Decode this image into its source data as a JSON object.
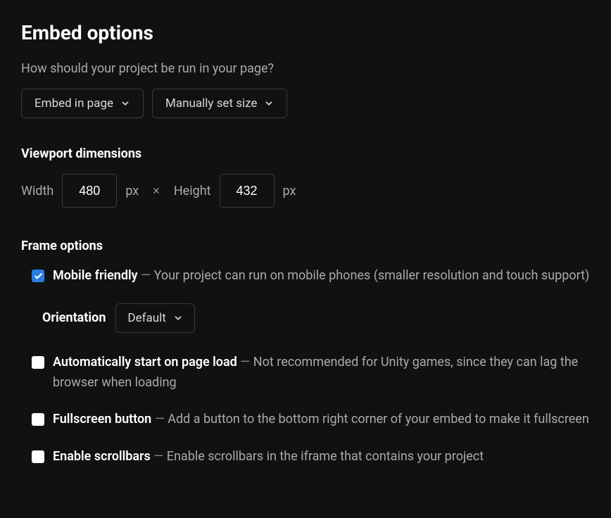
{
  "title": "Embed options",
  "question": "How should your project be run in your page?",
  "dropdowns": {
    "embed_mode": "Embed in page",
    "size_mode": "Manually set size"
  },
  "viewport": {
    "header": "Viewport dimensions",
    "width_label": "Width",
    "width_value": "480",
    "height_label": "Height",
    "height_value": "432",
    "unit": "px",
    "times": "×"
  },
  "frame": {
    "header": "Frame options",
    "mobile": {
      "label": "Mobile friendly",
      "description": "Your project can run on mobile phones (smaller resolution and touch support)",
      "checked": true
    },
    "orientation": {
      "label": "Orientation",
      "value": "Default"
    },
    "autostart": {
      "label": "Automatically start on page load",
      "description": "Not recommended for Unity games, since they can lag the browser when loading",
      "checked": false
    },
    "fullscreen": {
      "label": "Fullscreen button",
      "description": "Add a button to the bottom right corner of your embed to make it fullscreen",
      "checked": false
    },
    "scrollbars": {
      "label": "Enable scrollbars",
      "description": "Enable scrollbars in the iframe that contains your project",
      "checked": false
    }
  },
  "dash": " — "
}
